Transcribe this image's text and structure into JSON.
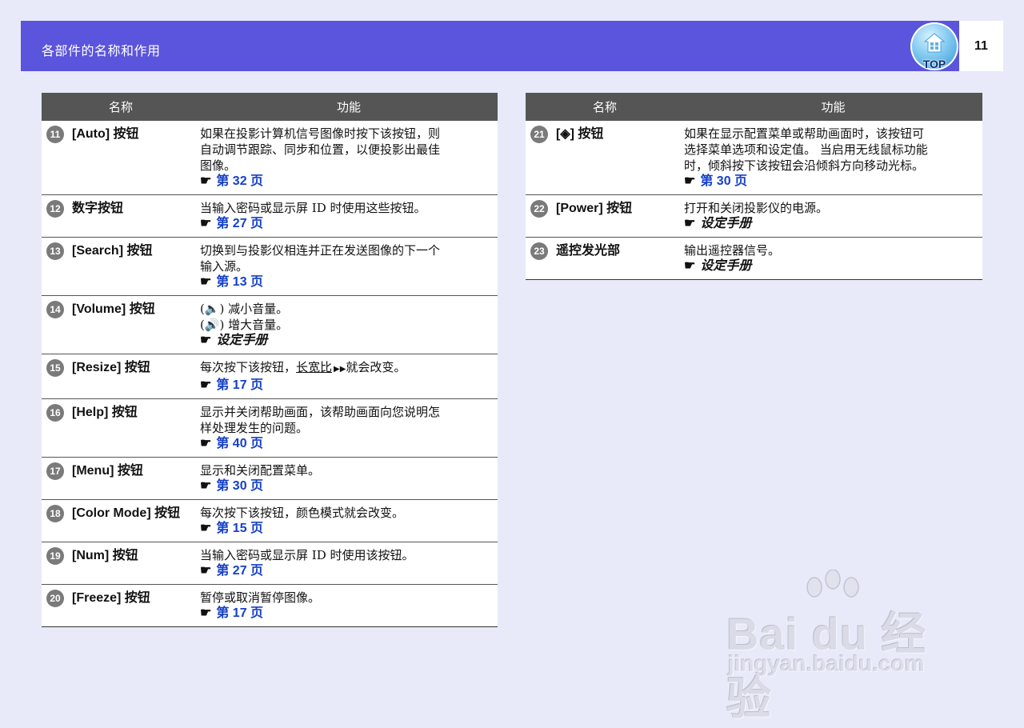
{
  "header": {
    "title": "各部件的名称和作用",
    "page_number": "11",
    "top_label": "TOP"
  },
  "table_header": {
    "name": "名称",
    "function": "功能"
  },
  "left_rows": [
    {
      "num": "11",
      "name": "[Auto] 按钮",
      "desc": [
        "如果在投影计算机信号图像时按下该按钮，则",
        "自动调节跟踪、同步和位置，以便投影出最佳",
        "图像。"
      ],
      "ref": "第 32 页"
    },
    {
      "num": "12",
      "name": "数字按钮",
      "desc": [
        "当输入密码或显示屏 ID 时使用这些按钮。"
      ],
      "ref": "第 27 页"
    },
    {
      "num": "13",
      "name": "[Search] 按钮",
      "desc": [
        "切换到与投影仪相连并正在发送图像的下一个",
        "输入源。"
      ],
      "ref": "第 13 页"
    },
    {
      "num": "14",
      "name": "[Volume] 按钮",
      "desc": [
        "(🔈) 减小音量。",
        "(🔊) 增大音量。"
      ],
      "manual": "设定手册"
    },
    {
      "num": "15",
      "name": "[Resize] 按钮",
      "desc_prefix": "每次按下该按钮，",
      "desc_link": "长宽比",
      "desc_suffix": "就会改变。",
      "ref": "第 17 页"
    },
    {
      "num": "16",
      "name": "[Help] 按钮",
      "desc": [
        "显示并关闭帮助画面，该帮助画面向您说明怎",
        "样处理发生的问题。"
      ],
      "ref": "第 40 页"
    },
    {
      "num": "17",
      "name": "[Menu] 按钮",
      "desc": [
        "显示和关闭配置菜单。"
      ],
      "ref": "第 30 页"
    },
    {
      "num": "18",
      "name": "[Color Mode] 按钮",
      "desc": [
        "每次按下该按钮，颜色模式就会改变。"
      ],
      "ref": "第 15 页"
    },
    {
      "num": "19",
      "name": "[Num] 按钮",
      "desc": [
        "当输入密码或显示屏 ID 时使用该按钮。"
      ],
      "ref": "第 27 页"
    },
    {
      "num": "20",
      "name": "[Freeze] 按钮",
      "desc": [
        "暂停或取消暂停图像。"
      ],
      "ref": "第 17 页"
    }
  ],
  "right_rows": [
    {
      "num": "21",
      "name": "[◈] 按钮",
      "desc": [
        "如果在显示配置菜单或帮助画面时，该按钮可",
        "选择菜单选项和设定值。 当启用无线鼠标功能",
        "时，倾斜按下该按钮会沿倾斜方向移动光标。"
      ],
      "ref": "第 30 页"
    },
    {
      "num": "22",
      "name": "[Power] 按钮",
      "desc": [
        "打开和关闭投影仪的电源。"
      ],
      "manual": "设定手册"
    },
    {
      "num": "23",
      "name": "遥控发光部",
      "desc": [
        "输出遥控器信号。"
      ],
      "manual": "设定手册"
    }
  ],
  "hand_symbol": "☛",
  "watermark": {
    "main": "Bai du 经验",
    "url": "jingyan.baidu.com"
  },
  "colors": {
    "header": "#5b54dc",
    "table_head": "#555555",
    "link": "#1640c8",
    "background": "#e8eafa"
  }
}
